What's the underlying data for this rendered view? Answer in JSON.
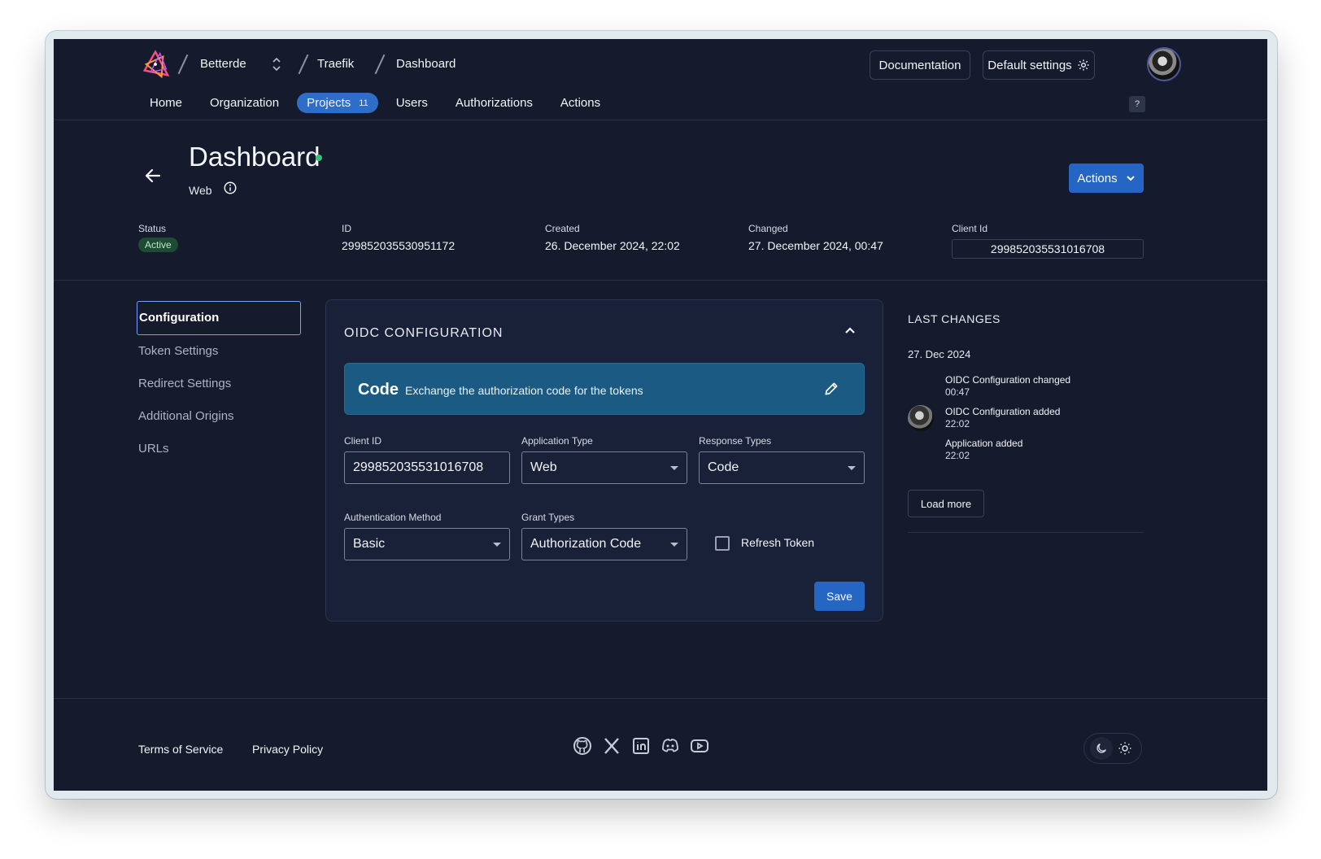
{
  "header": {
    "org": "Betterde",
    "project": "Traefik",
    "app": "Dashboard",
    "documentation_label": "Documentation",
    "default_settings_label": "Default settings"
  },
  "nav": {
    "items": [
      {
        "label": "Home"
      },
      {
        "label": "Organization"
      },
      {
        "label": "Projects",
        "count": "11"
      },
      {
        "label": "Users"
      },
      {
        "label": "Authorizations"
      },
      {
        "label": "Actions"
      }
    ],
    "help_label": "?"
  },
  "page": {
    "title": "Dashboard",
    "subtitle": "Web",
    "actions_label": "Actions",
    "meta": {
      "status_label": "Status",
      "status_value": "Active",
      "id_label": "ID",
      "id_value": "299852035530951172",
      "created_label": "Created",
      "created_value": "26. December 2024, 22:02",
      "changed_label": "Changed",
      "changed_value": "27. December 2024, 00:47",
      "clientid_label": "Client Id",
      "clientid_value": "299852035531016708"
    }
  },
  "sidebar": {
    "items": [
      {
        "label": "Configuration"
      },
      {
        "label": "Token Settings"
      },
      {
        "label": "Redirect Settings"
      },
      {
        "label": "Additional Origins"
      },
      {
        "label": "URLs"
      }
    ]
  },
  "oidc": {
    "title": "OIDC CONFIGURATION",
    "banner_title": "Code",
    "banner_desc": "Exchange the authorization code for the tokens",
    "client_id_label": "Client ID",
    "client_id_value": "299852035531016708",
    "app_type_label": "Application Type",
    "app_type_value": "Web",
    "response_types_label": "Response Types",
    "response_types_value": "Code",
    "auth_method_label": "Authentication Method",
    "auth_method_value": "Basic",
    "grant_types_label": "Grant Types",
    "grant_types_value": "Authorization Code",
    "refresh_token_label": "Refresh Token",
    "save_label": "Save"
  },
  "changes": {
    "title": "LAST CHANGES",
    "date": "27. Dec 2024",
    "items": [
      {
        "text": "OIDC Configuration changed",
        "time": "00:47"
      },
      {
        "text": "OIDC Configuration added",
        "time": "22:02"
      },
      {
        "text": "Application added",
        "time": "22:02"
      }
    ],
    "load_more_label": "Load more"
  },
  "footer": {
    "terms": "Terms of Service",
    "privacy": "Privacy Policy",
    "socials": [
      "github-icon",
      "x-icon",
      "linkedin-icon",
      "discord-icon",
      "youtube-icon"
    ]
  },
  "colors": {
    "background": "#151b2c",
    "accent": "#2565c3",
    "banner": "#1b5a83",
    "status_dot": "#36c27a"
  }
}
